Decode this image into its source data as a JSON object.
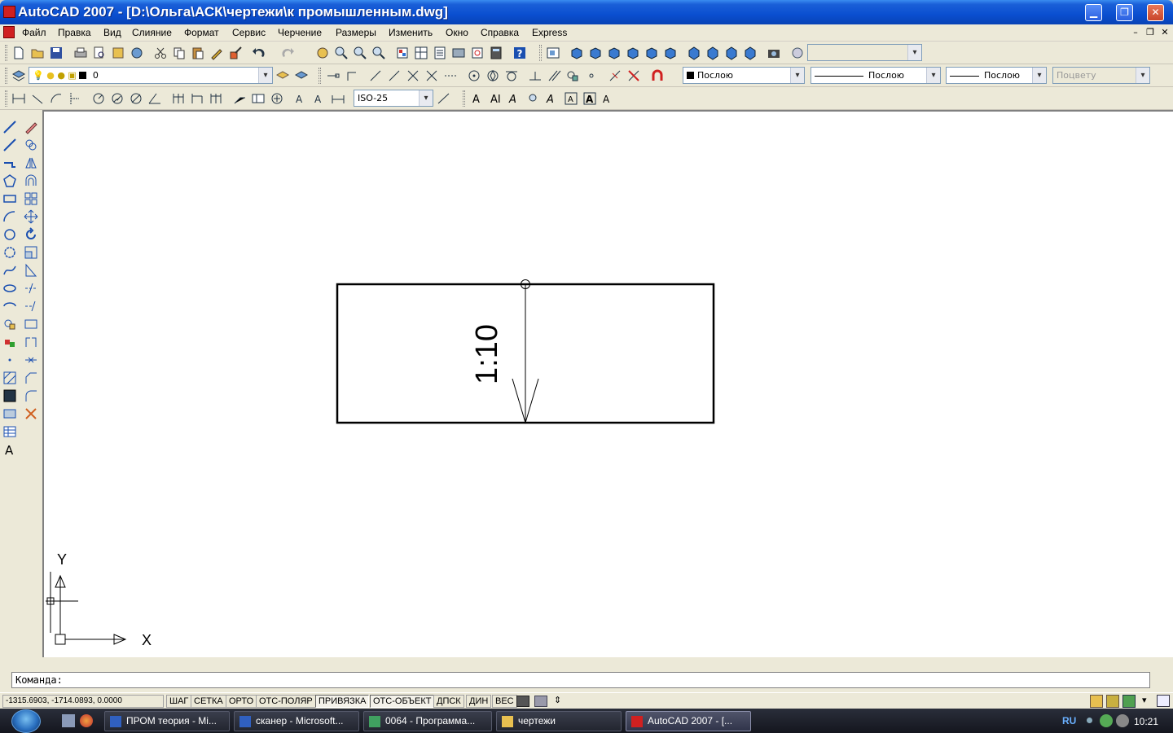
{
  "window": {
    "title": "AutoCAD 2007 - [D:\\Ольга\\АСК\\чертежи\\к промышленным.dwg]",
    "min_label": "▁",
    "max_label": "❐",
    "close_label": "✕"
  },
  "menu": {
    "items": [
      "Файл",
      "Правка",
      "Вид",
      "Слияние",
      "Формат",
      "Сервис",
      "Черчение",
      "Размеры",
      "Изменить",
      "Окно",
      "Справка",
      "Express"
    ],
    "doc_min": "–",
    "doc_restore": "❐",
    "doc_close": "✕"
  },
  "layers": {
    "current_layer": "0"
  },
  "properties": {
    "color": "Послою",
    "linetype": "Послою",
    "lineweight": "Послою",
    "plotstyle": "Поцвету"
  },
  "dimension": {
    "style": "ISO-25"
  },
  "drawing": {
    "text": "1:10",
    "ucs_x": "X",
    "ucs_y": "Y"
  },
  "command": {
    "prompt": "Команда:"
  },
  "status": {
    "coords": "-1315.6903, -1714.0893, 0.0000",
    "buttons": [
      {
        "label": "ШАГ",
        "on": false
      },
      {
        "label": "СЕТКА",
        "on": false
      },
      {
        "label": "ОРТО",
        "on": false
      },
      {
        "label": "ОТС-ПОЛЯР",
        "on": false
      },
      {
        "label": "ПРИВЯЗКА",
        "on": true
      },
      {
        "label": "ОТС-ОБЪЕКТ",
        "on": true
      },
      {
        "label": "ДПСК",
        "on": false
      },
      {
        "label": "ДИН",
        "on": false
      },
      {
        "label": "ВЕС",
        "on": false
      }
    ]
  },
  "taskbar": {
    "tasks": [
      {
        "label": "ПРОМ теория - Mi...",
        "active": false
      },
      {
        "label": "сканер - Microsoft...",
        "active": false
      },
      {
        "label": "0064 - Программа...",
        "active": false
      },
      {
        "label": "чертежи",
        "active": false
      },
      {
        "label": "AutoCAD 2007 - [...",
        "active": true
      }
    ],
    "lang": "RU",
    "clock": "10:21"
  },
  "colors": {
    "titlebar": "#0a4fd0",
    "toolbar_bg": "#ece9d8",
    "canvas_bg": "#ffffff",
    "taskbar_bg": "#1c1f28"
  }
}
